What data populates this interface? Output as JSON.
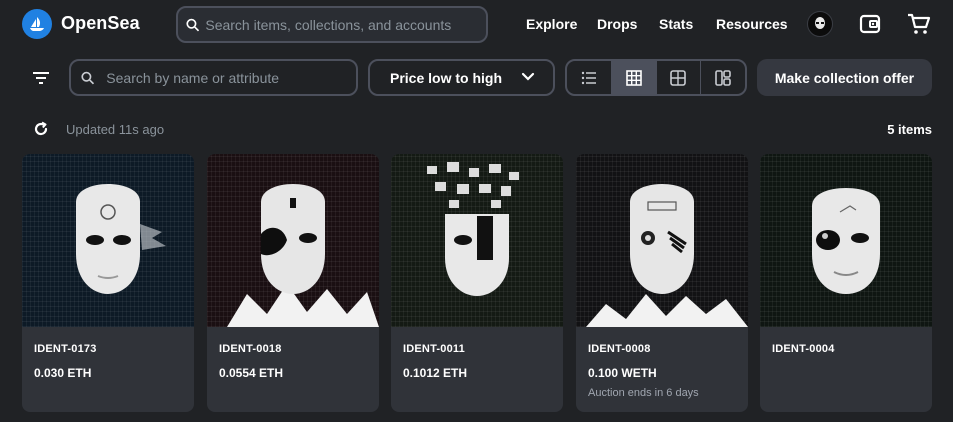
{
  "brand": {
    "name": "OpenSea",
    "accent": "#2081e2"
  },
  "topnav": {
    "search_placeholder": "Search items, collections, and accounts",
    "links": [
      "Explore",
      "Drops",
      "Stats",
      "Resources"
    ]
  },
  "toolbar": {
    "filter_placeholder": "Search by name or attribute",
    "sort_selected": "Price low to high",
    "offer_label": "Make collection offer"
  },
  "status": {
    "updated": "Updated 11s ago",
    "count": "5 items"
  },
  "items": [
    {
      "title": "IDENT-0173",
      "price": "0.030 ETH",
      "sub": ""
    },
    {
      "title": "IDENT-0018",
      "price": "0.0554 ETH",
      "sub": ""
    },
    {
      "title": "IDENT-0011",
      "price": "0.1012 ETH",
      "sub": ""
    },
    {
      "title": "IDENT-0008",
      "price": "0.100 WETH",
      "sub": "Auction ends in 6 days"
    },
    {
      "title": "IDENT-0004",
      "price": "",
      "sub": ""
    }
  ]
}
